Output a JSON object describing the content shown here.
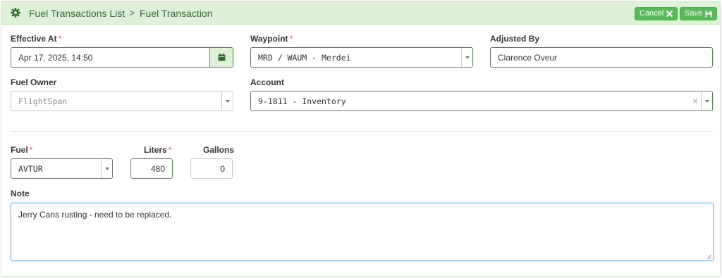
{
  "breadcrumb": {
    "parent": "Fuel Transactions List",
    "separator": ">",
    "current": "Fuel Transaction"
  },
  "actions": {
    "cancel_label": "Cancel",
    "save_label": "Save"
  },
  "form": {
    "effective_at": {
      "label": "Effective At",
      "required_mark": "*",
      "value": "Apr 17, 2025, 14:50",
      "icon": "calendar-icon"
    },
    "waypoint": {
      "label": "Waypoint",
      "required_mark": "*",
      "value": "MRD / WAUM - Merdei"
    },
    "adjusted_by": {
      "label": "Adjusted By",
      "value": "Clarence Oveur"
    },
    "fuel_owner": {
      "label": "Fuel Owner",
      "value": "FlightSpan"
    },
    "account": {
      "label": "Account",
      "value": "9-1811 - Inventory",
      "clear_glyph": "×"
    },
    "fuel": {
      "label": "Fuel",
      "required_mark": "*",
      "value": "AVTUR"
    },
    "liters": {
      "label": "Liters",
      "required_mark": "*",
      "value": "480"
    },
    "gallons": {
      "label": "Gallons",
      "value": "0"
    },
    "note": {
      "label": "Note",
      "value": "Jerry Cans rusting - need to be replaced."
    }
  },
  "colors": {
    "header_bg": "#dff0d8",
    "header_text": "#2f6b2f",
    "button_green": "#5cb85c",
    "required_red": "#e05a4f",
    "focus_blue": "#7fb1e3"
  }
}
